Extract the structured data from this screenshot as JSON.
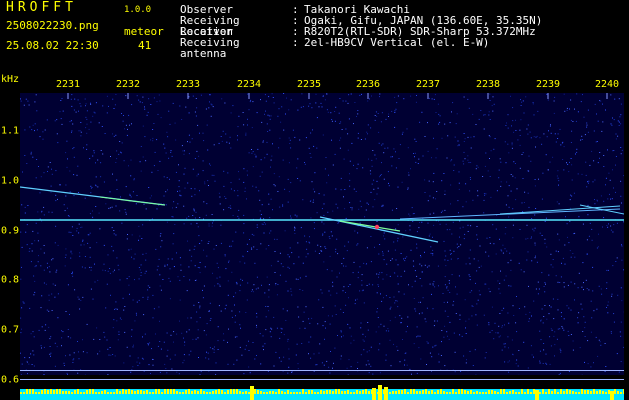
{
  "header": {
    "title": "HROFFT",
    "version": "1.0.0",
    "filename": "2508022230.png",
    "datetime": "25.08.02 22:30",
    "meteor_label": "meteor",
    "meteor_count": "41"
  },
  "info": {
    "rows": [
      {
        "key": "Observer",
        "value": "Takanori Kawachi"
      },
      {
        "key": "Receiving Location",
        "value": "Ogaki, Gifu, JAPAN (136.60E, 35.35N)"
      },
      {
        "key": "Receiver",
        "value": "R820T2(RTL-SDR) SDR-Sharp 53.372MHz"
      },
      {
        "key": "Receiving antenna",
        "value": "2el-HB9CV Vertical (el. E-W)"
      }
    ],
    "separator": ":"
  },
  "axes": {
    "freq_unit": "kHz",
    "time_labels": [
      "2231",
      "2232",
      "2233",
      "2234",
      "2235",
      "2236",
      "2237",
      "2238",
      "2239",
      "2240"
    ],
    "freq_labels": [
      "1.1",
      "1.0",
      "0.9",
      "0.8",
      "0.7",
      "0.6"
    ]
  },
  "colors": {
    "label": "#ffff00",
    "text": "#ffffff",
    "background": "#000000",
    "plot_bg": "#000033",
    "carrier": "#57e8ff",
    "level_cyan": "#00e5ff",
    "level_yellow": "#ffff00"
  }
}
